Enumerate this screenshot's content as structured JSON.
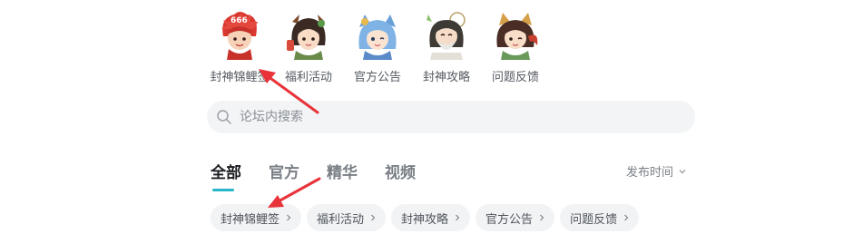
{
  "quick_links": [
    {
      "label": "封神锦鲤签",
      "icon": "red-hair-character-icon"
    },
    {
      "label": "福利活动",
      "icon": "dark-hair-character-icon"
    },
    {
      "label": "官方公告",
      "icon": "blue-hair-character-icon"
    },
    {
      "label": "封神攻略",
      "icon": "mustache-character-icon"
    },
    {
      "label": "问题反馈",
      "icon": "fox-ear-character-icon"
    }
  ],
  "search": {
    "placeholder": "论坛内搜索",
    "icon": "search-icon"
  },
  "tabs": [
    {
      "label": "全部",
      "active": true
    },
    {
      "label": "官方",
      "active": false
    },
    {
      "label": "精华",
      "active": false
    },
    {
      "label": "视频",
      "active": false
    }
  ],
  "sort": {
    "label": "发布时间",
    "icon": "chevron-down-icon"
  },
  "chips": [
    {
      "label": "封神锦鲤签"
    },
    {
      "label": "福利活动"
    },
    {
      "label": "封神攻略"
    },
    {
      "label": "官方公告"
    },
    {
      "label": "问题反馈"
    }
  ],
  "colors": {
    "accent": "#27b7c9",
    "annotation": "#e8333a"
  }
}
